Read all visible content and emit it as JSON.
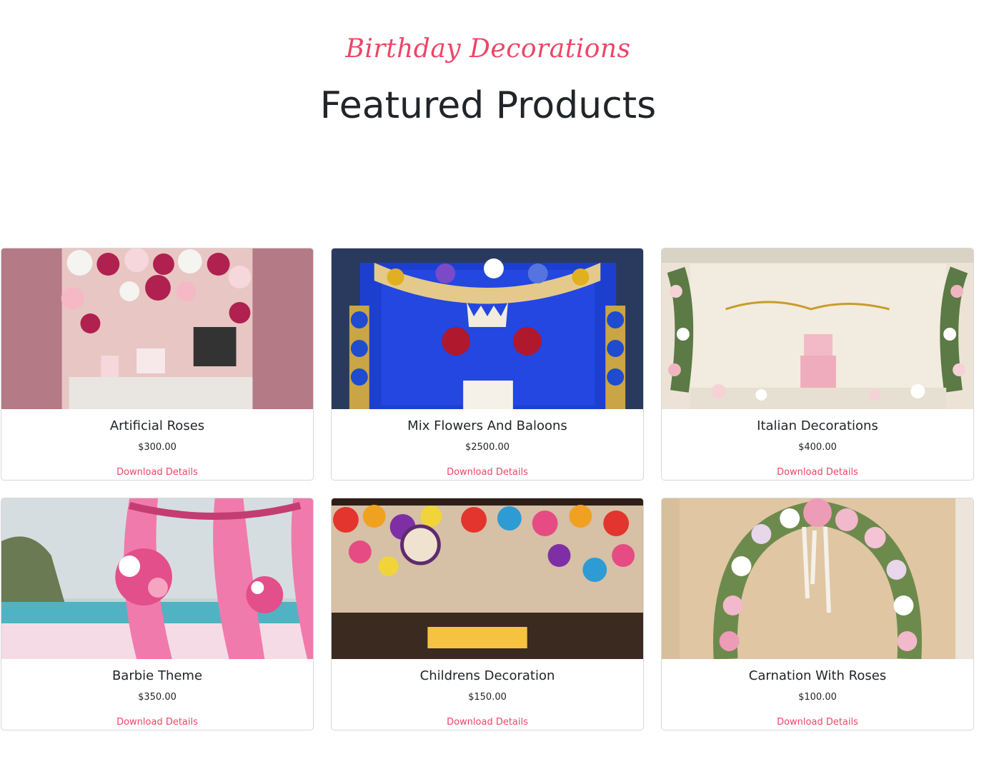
{
  "header": {
    "subtitle": "Birthday Decorations",
    "title": "Featured Products"
  },
  "colors": {
    "accent": "#ec4668",
    "text": "#212529"
  },
  "products": [
    {
      "name": "Artificial Roses",
      "price": "$300.00",
      "link": "Download Details",
      "image": "artificial-roses-image"
    },
    {
      "name": "Mix Flowers And Baloons",
      "price": "$2500.00",
      "link": "Download Details",
      "image": "mix-flowers-balloons-image"
    },
    {
      "name": "Italian Decorations",
      "price": "$400.00",
      "link": "Download Details",
      "image": "italian-decorations-image"
    },
    {
      "name": "Barbie Theme",
      "price": "$350.00",
      "link": "Download Details",
      "image": "barbie-theme-image"
    },
    {
      "name": "Childrens Decoration",
      "price": "$150.00",
      "link": "Download Details",
      "image": "childrens-decoration-image"
    },
    {
      "name": "Carnation With Roses",
      "price": "$100.00",
      "link": "Download Details",
      "image": "carnation-roses-image"
    }
  ]
}
